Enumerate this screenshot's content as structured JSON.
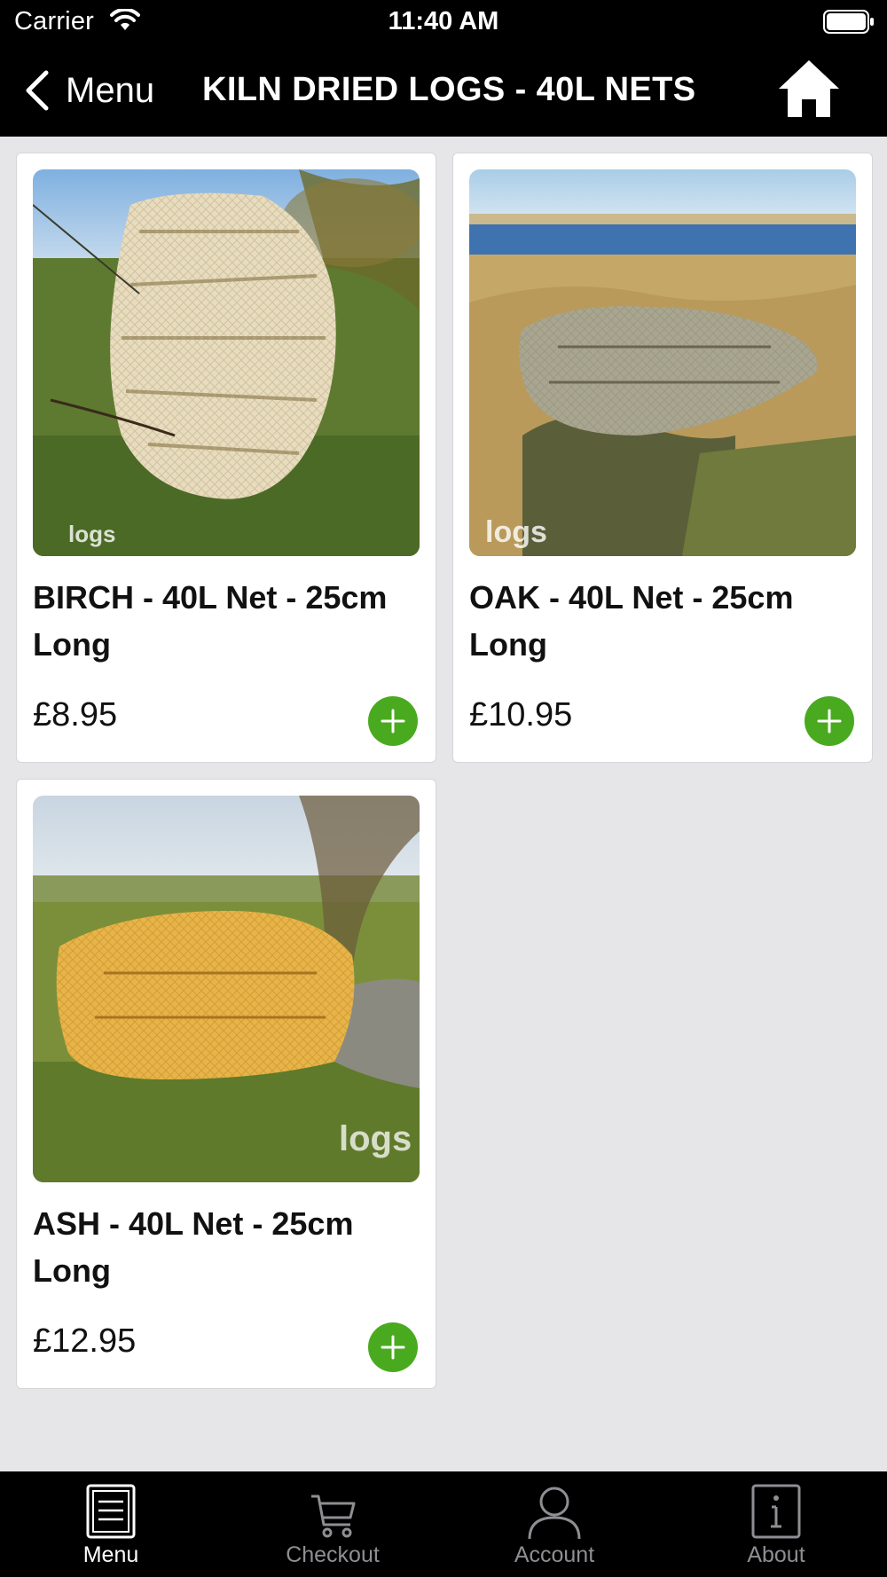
{
  "status_bar": {
    "carrier": "Carrier",
    "time": "11:40 AM"
  },
  "nav": {
    "back_label": "Menu",
    "title": "KILN DRIED LOGS - 40L NETS"
  },
  "products": [
    {
      "name": "BIRCH - 40L Net - 25cm Long",
      "price": "£8.95",
      "image": "birch-log-net-photo"
    },
    {
      "name": "OAK - 40L Net - 25cm Long",
      "price": "£10.95",
      "image": "oak-log-net-photo"
    },
    {
      "name": "ASH - 40L Net - 25cm Long",
      "price": "£12.95",
      "image": "ash-log-net-photo"
    }
  ],
  "tabs": [
    {
      "label": "Menu",
      "icon": "menu-document-icon",
      "active": true
    },
    {
      "label": "Checkout",
      "icon": "cart-icon",
      "active": false
    },
    {
      "label": "Account",
      "icon": "person-icon",
      "active": false
    },
    {
      "label": "About",
      "icon": "info-icon",
      "active": false
    }
  ],
  "colors": {
    "bars": "#000000",
    "background": "#e6e6e9",
    "add_button": "#4aaa1f",
    "tab_active": "#ffffff",
    "tab_inactive": "#8e8e93"
  }
}
